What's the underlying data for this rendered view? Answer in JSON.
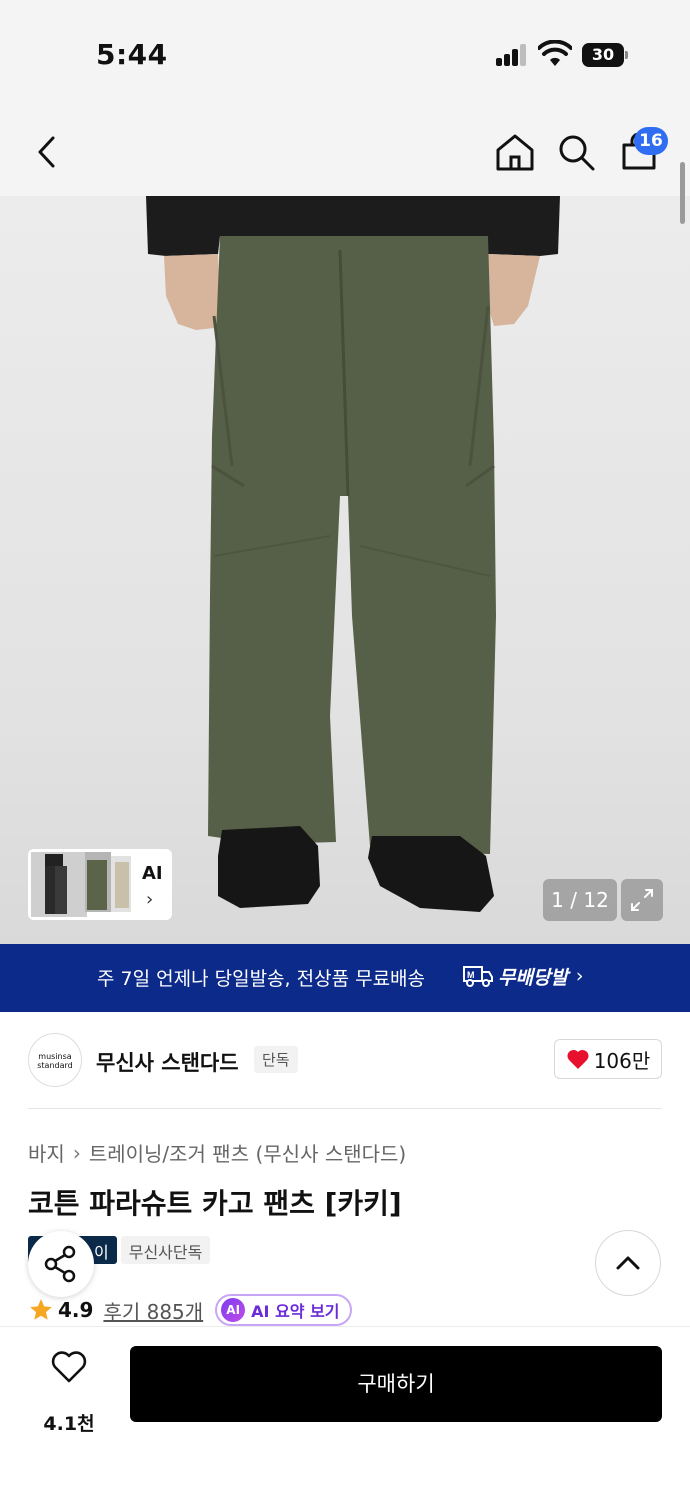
{
  "status_bar": {
    "time": "5:44",
    "battery": "30"
  },
  "nav": {
    "cart_count": "16"
  },
  "gallery": {
    "counter": "1 / 12",
    "thumb_label": "AI"
  },
  "promo": {
    "text": "주 7일 언제나 당일발송, 전상품 무료배송",
    "brand": "무배당발"
  },
  "brand": {
    "logo_line1": "musinsa",
    "logo_line2": "standard",
    "name": "무신사 스탠다드",
    "tag": "단독",
    "likes": "106만"
  },
  "breadcrumb": {
    "cat1": "바지",
    "cat2": "트레이닝/조거 팬츠 (무신사 스탠다드)"
  },
  "product": {
    "title": "코튼 파라슈트 카고 팬츠 [카키]",
    "tags": [
      "이",
      "무신사단독"
    ],
    "rating": "4.9",
    "reviews": "후기 885개",
    "ai_badge": "AI",
    "ai_summary": "AI 요약 보기"
  },
  "bottom_bar": {
    "wish_count": "4.1천",
    "buy_label": "구매하기"
  },
  "colors": {
    "promo_bg": "#0b2a8a",
    "badge": "#2f6ef2",
    "heart": "#e8112d",
    "star": "#f5a623",
    "buy_bg": "#000000"
  }
}
